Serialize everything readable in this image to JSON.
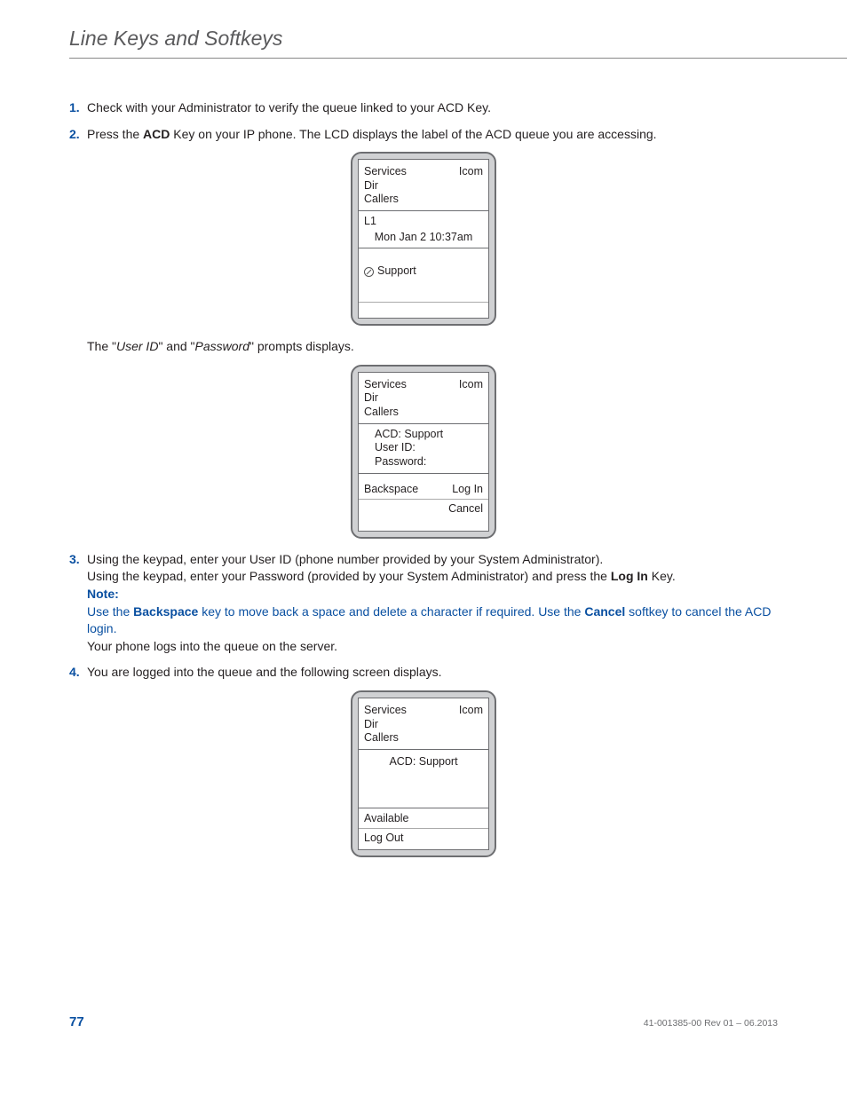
{
  "header": {
    "title": "Line Keys and Softkeys"
  },
  "steps": {
    "s1": {
      "num": "1.",
      "text": "Check with your Administrator to verify the queue linked to your ACD Key."
    },
    "s2": {
      "num": "2.",
      "pre": "Press the ",
      "bold": "ACD",
      "post": " Key on your IP phone. The LCD displays the label of the ACD queue you are accessing."
    },
    "prompt": {
      "pre": "The \"",
      "uid": "User ID",
      "mid": "\" and \"",
      "pwd": "Password",
      "post": "\" prompts displays."
    },
    "s3": {
      "num": "3.",
      "line1": "Using the keypad, enter your User ID (phone number provided by your System Administrator).",
      "line2_pre": "Using the keypad, enter your Password (provided by your System Administrator) and press the ",
      "line2_bold": "Log In",
      "line2_post": " Key.",
      "note_label": "Note:",
      "note_a": "Use the ",
      "note_bs": "Backspace",
      "note_b": " key to move back a space and delete a character if required. Use the ",
      "note_cancel": "Cancel",
      "note_c": " softkey to cancel the ACD login.",
      "line3": "Your phone logs into the queue on the server."
    },
    "s4": {
      "num": "4.",
      "text": "You are logged into the queue and the following screen displays."
    }
  },
  "lcd1": {
    "services": "Services",
    "icom": "Icom",
    "dir": "Dir",
    "callers": "Callers",
    "l1": "L1",
    "time": "Mon Jan 2 10:37am",
    "support": "Support"
  },
  "lcd2": {
    "services": "Services",
    "icom": "Icom",
    "dir": "Dir",
    "callers": "Callers",
    "acd": "ACD: Support",
    "uid": "User ID:",
    "pwd": "Password:",
    "backspace": "Backspace",
    "login": "Log In",
    "cancel": "Cancel"
  },
  "lcd3": {
    "services": "Services",
    "icom": "Icom",
    "dir": "Dir",
    "callers": "Callers",
    "acd": "ACD: Support",
    "available": "Available",
    "logout": "Log Out"
  },
  "footer": {
    "page": "77",
    "rev": "41-001385-00 Rev 01 – 06.2013"
  }
}
